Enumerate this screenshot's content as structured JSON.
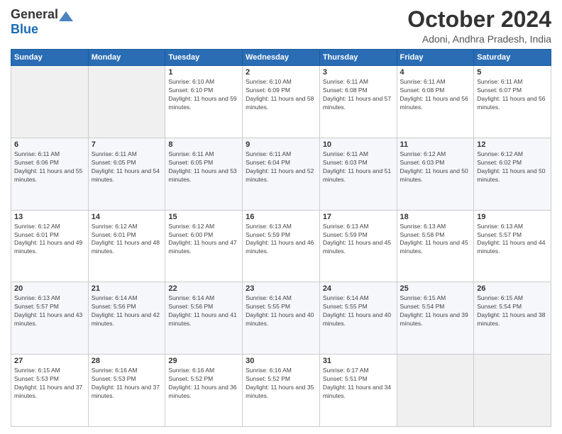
{
  "logo": {
    "general": "General",
    "blue": "Blue"
  },
  "header": {
    "month": "October 2024",
    "location": "Adoni, Andhra Pradesh, India"
  },
  "days_of_week": [
    "Sunday",
    "Monday",
    "Tuesday",
    "Wednesday",
    "Thursday",
    "Friday",
    "Saturday"
  ],
  "weeks": [
    [
      {
        "day": "",
        "sunrise": "",
        "sunset": "",
        "daylight": ""
      },
      {
        "day": "",
        "sunrise": "",
        "sunset": "",
        "daylight": ""
      },
      {
        "day": "1",
        "sunrise": "Sunrise: 6:10 AM",
        "sunset": "Sunset: 6:10 PM",
        "daylight": "Daylight: 11 hours and 59 minutes."
      },
      {
        "day": "2",
        "sunrise": "Sunrise: 6:10 AM",
        "sunset": "Sunset: 6:09 PM",
        "daylight": "Daylight: 11 hours and 58 minutes."
      },
      {
        "day": "3",
        "sunrise": "Sunrise: 6:11 AM",
        "sunset": "Sunset: 6:08 PM",
        "daylight": "Daylight: 11 hours and 57 minutes."
      },
      {
        "day": "4",
        "sunrise": "Sunrise: 6:11 AM",
        "sunset": "Sunset: 6:08 PM",
        "daylight": "Daylight: 11 hours and 56 minutes."
      },
      {
        "day": "5",
        "sunrise": "Sunrise: 6:11 AM",
        "sunset": "Sunset: 6:07 PM",
        "daylight": "Daylight: 11 hours and 56 minutes."
      }
    ],
    [
      {
        "day": "6",
        "sunrise": "Sunrise: 6:11 AM",
        "sunset": "Sunset: 6:06 PM",
        "daylight": "Daylight: 11 hours and 55 minutes."
      },
      {
        "day": "7",
        "sunrise": "Sunrise: 6:11 AM",
        "sunset": "Sunset: 6:05 PM",
        "daylight": "Daylight: 11 hours and 54 minutes."
      },
      {
        "day": "8",
        "sunrise": "Sunrise: 6:11 AM",
        "sunset": "Sunset: 6:05 PM",
        "daylight": "Daylight: 11 hours and 53 minutes."
      },
      {
        "day": "9",
        "sunrise": "Sunrise: 6:11 AM",
        "sunset": "Sunset: 6:04 PM",
        "daylight": "Daylight: 11 hours and 52 minutes."
      },
      {
        "day": "10",
        "sunrise": "Sunrise: 6:11 AM",
        "sunset": "Sunset: 6:03 PM",
        "daylight": "Daylight: 11 hours and 51 minutes."
      },
      {
        "day": "11",
        "sunrise": "Sunrise: 6:12 AM",
        "sunset": "Sunset: 6:03 PM",
        "daylight": "Daylight: 11 hours and 50 minutes."
      },
      {
        "day": "12",
        "sunrise": "Sunrise: 6:12 AM",
        "sunset": "Sunset: 6:02 PM",
        "daylight": "Daylight: 11 hours and 50 minutes."
      }
    ],
    [
      {
        "day": "13",
        "sunrise": "Sunrise: 6:12 AM",
        "sunset": "Sunset: 6:01 PM",
        "daylight": "Daylight: 11 hours and 49 minutes."
      },
      {
        "day": "14",
        "sunrise": "Sunrise: 6:12 AM",
        "sunset": "Sunset: 6:01 PM",
        "daylight": "Daylight: 11 hours and 48 minutes."
      },
      {
        "day": "15",
        "sunrise": "Sunrise: 6:12 AM",
        "sunset": "Sunset: 6:00 PM",
        "daylight": "Daylight: 11 hours and 47 minutes."
      },
      {
        "day": "16",
        "sunrise": "Sunrise: 6:13 AM",
        "sunset": "Sunset: 5:59 PM",
        "daylight": "Daylight: 11 hours and 46 minutes."
      },
      {
        "day": "17",
        "sunrise": "Sunrise: 6:13 AM",
        "sunset": "Sunset: 5:59 PM",
        "daylight": "Daylight: 11 hours and 45 minutes."
      },
      {
        "day": "18",
        "sunrise": "Sunrise: 6:13 AM",
        "sunset": "Sunset: 5:58 PM",
        "daylight": "Daylight: 11 hours and 45 minutes."
      },
      {
        "day": "19",
        "sunrise": "Sunrise: 6:13 AM",
        "sunset": "Sunset: 5:57 PM",
        "daylight": "Daylight: 11 hours and 44 minutes."
      }
    ],
    [
      {
        "day": "20",
        "sunrise": "Sunrise: 6:13 AM",
        "sunset": "Sunset: 5:57 PM",
        "daylight": "Daylight: 11 hours and 43 minutes."
      },
      {
        "day": "21",
        "sunrise": "Sunrise: 6:14 AM",
        "sunset": "Sunset: 5:56 PM",
        "daylight": "Daylight: 11 hours and 42 minutes."
      },
      {
        "day": "22",
        "sunrise": "Sunrise: 6:14 AM",
        "sunset": "Sunset: 5:56 PM",
        "daylight": "Daylight: 11 hours and 41 minutes."
      },
      {
        "day": "23",
        "sunrise": "Sunrise: 6:14 AM",
        "sunset": "Sunset: 5:55 PM",
        "daylight": "Daylight: 11 hours and 40 minutes."
      },
      {
        "day": "24",
        "sunrise": "Sunrise: 6:14 AM",
        "sunset": "Sunset: 5:55 PM",
        "daylight": "Daylight: 11 hours and 40 minutes."
      },
      {
        "day": "25",
        "sunrise": "Sunrise: 6:15 AM",
        "sunset": "Sunset: 5:54 PM",
        "daylight": "Daylight: 11 hours and 39 minutes."
      },
      {
        "day": "26",
        "sunrise": "Sunrise: 6:15 AM",
        "sunset": "Sunset: 5:54 PM",
        "daylight": "Daylight: 11 hours and 38 minutes."
      }
    ],
    [
      {
        "day": "27",
        "sunrise": "Sunrise: 6:15 AM",
        "sunset": "Sunset: 5:53 PM",
        "daylight": "Daylight: 11 hours and 37 minutes."
      },
      {
        "day": "28",
        "sunrise": "Sunrise: 6:16 AM",
        "sunset": "Sunset: 5:53 PM",
        "daylight": "Daylight: 11 hours and 37 minutes."
      },
      {
        "day": "29",
        "sunrise": "Sunrise: 6:16 AM",
        "sunset": "Sunset: 5:52 PM",
        "daylight": "Daylight: 11 hours and 36 minutes."
      },
      {
        "day": "30",
        "sunrise": "Sunrise: 6:16 AM",
        "sunset": "Sunset: 5:52 PM",
        "daylight": "Daylight: 11 hours and 35 minutes."
      },
      {
        "day": "31",
        "sunrise": "Sunrise: 6:17 AM",
        "sunset": "Sunset: 5:51 PM",
        "daylight": "Daylight: 11 hours and 34 minutes."
      },
      {
        "day": "",
        "sunrise": "",
        "sunset": "",
        "daylight": ""
      },
      {
        "day": "",
        "sunrise": "",
        "sunset": "",
        "daylight": ""
      }
    ]
  ]
}
